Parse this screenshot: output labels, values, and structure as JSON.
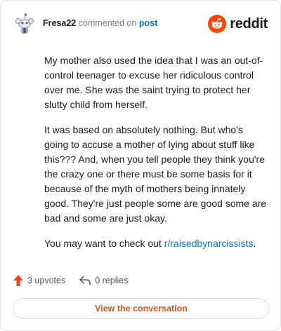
{
  "comment": {
    "author": "Fresa22",
    "action": "commented on",
    "target": "post",
    "paragraphs": [
      "My mother also used the idea that I was an out-of-control teenager to excuse her ridiculous control over me. She was the saint trying to protect her slutty child from herself.",
      "It was based on absolutely nothing. But who's going to accuse a mother of lying about stuff like this??? And, when you tell people they think you're the crazy one or there must be some basis for it because of the myth of mothers being innately good. They're just people some are good some are bad and some are just okay."
    ],
    "last_line_prefix": "You may want to check out ",
    "last_line_link": "r/raisedbynarcissists",
    "last_line_suffix": "."
  },
  "brand": {
    "name": "reddit",
    "accent": "#ff4500"
  },
  "actions": {
    "upvotes": "3 upvotes",
    "replies": "0 replies"
  },
  "footer": {
    "view_label": "View the conversation"
  },
  "icons": [
    "snoo-avatar-icon",
    "reddit-logo-icon",
    "upvote-arrow-icon",
    "reply-arrow-icon"
  ]
}
